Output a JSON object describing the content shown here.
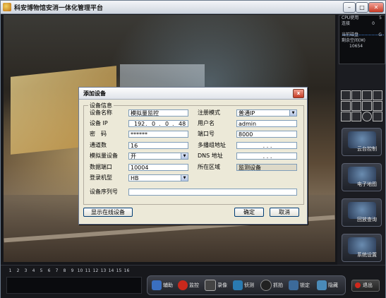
{
  "window": {
    "title": "科安博物馆安消一体化管理平台"
  },
  "stats": {
    "cpu_label": "CPU使用",
    "cpu_value": "5",
    "conn_label": "连接",
    "conn_value": "0",
    "disk_label": "当前磁盘",
    "disk_value": "G",
    "free_label": "剩余空间(M)",
    "free_value": "10654"
  },
  "sidepanel": {
    "btn1": "云台控制",
    "btn2": "电子地图",
    "btn3": "回放查询",
    "btn4": "系统设置"
  },
  "channels": [
    "1",
    "2",
    "3",
    "4",
    "5",
    "6",
    "7",
    "8",
    "9",
    "10",
    "11",
    "12",
    "13",
    "14",
    "15",
    "16"
  ],
  "toolbar": {
    "help": "辅助",
    "monitor": "监控",
    "record": "录像",
    "patrol": "侦测",
    "capture": "抓拍",
    "lock": "锁定",
    "hide": "隐藏"
  },
  "exit_label": "退出",
  "dialog": {
    "title": "添加设备",
    "close": "x",
    "group": "设备信息",
    "device_name_label": "设备名称",
    "device_name": "模拟量监控",
    "device_ip_label": "设备 IP",
    "ip": [
      "192",
      "0",
      "0",
      "48"
    ],
    "password_label": "密　码",
    "password": "******",
    "channels_label": "通道数",
    "channels": "16",
    "analog_label": "模拟量设备",
    "analog": "开",
    "data_port_label": "数据端口",
    "data_port": "10004",
    "model_label": "登录机型",
    "model": "HB",
    "reg_mode_label": "注册模式",
    "reg_mode": "普通IP",
    "user_label": "用户名",
    "user": "admin",
    "port_label": "端口号",
    "port": "8000",
    "multicast_label": "多播组地址",
    "multicast": ".   .   .",
    "dns_label": "DNS 地址",
    "dns": ".   .   .",
    "area_label": "所在区域",
    "area": "监测设备",
    "serial_label": "设备序列号",
    "serial": "",
    "show_online": "显示在线设备",
    "ok": "确定",
    "cancel": "取消"
  }
}
